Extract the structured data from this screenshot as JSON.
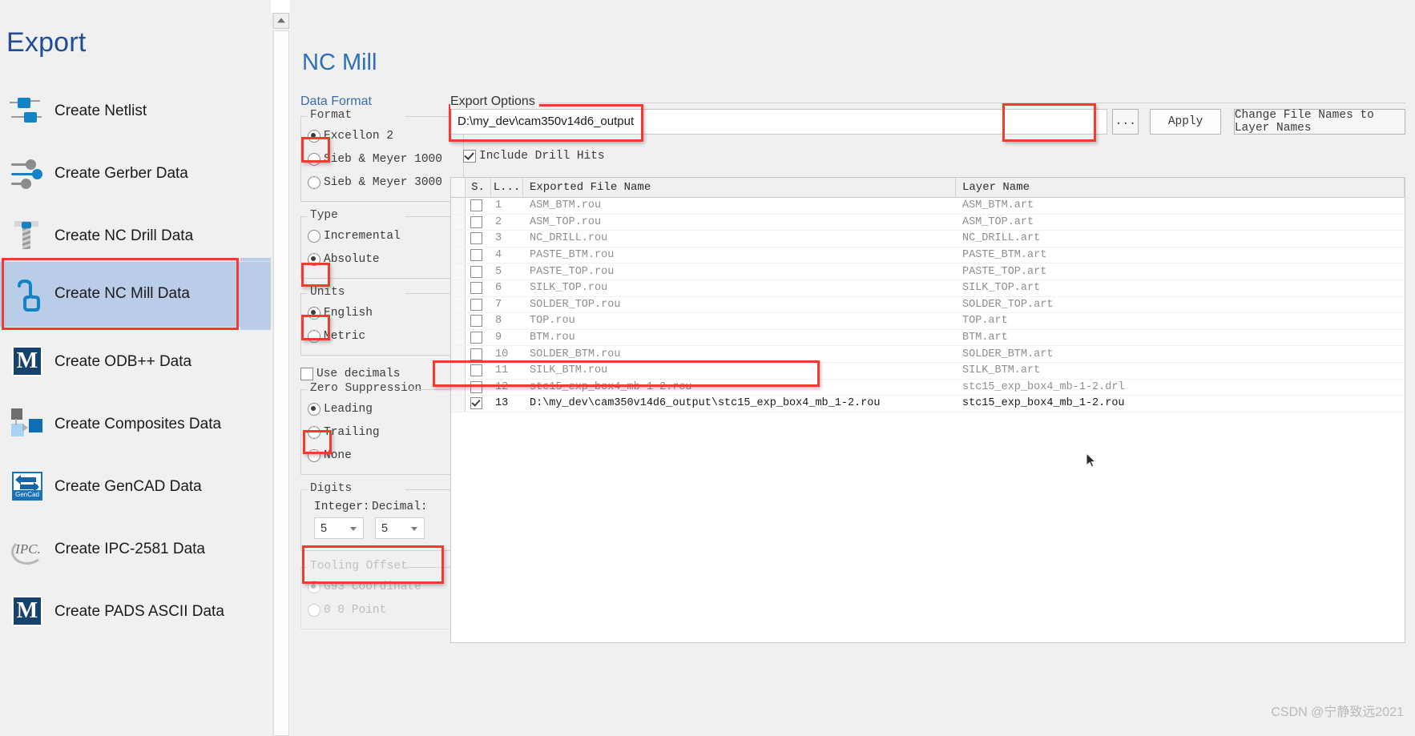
{
  "sidebar": {
    "title": "Export",
    "items": [
      {
        "label": "Create Netlist",
        "icon": "netlist-icon",
        "selected": false
      },
      {
        "label": "Create Gerber Data",
        "icon": "gerber-icon",
        "selected": false
      },
      {
        "label": "Create NC Drill Data",
        "icon": "drill-icon",
        "selected": false
      },
      {
        "label": "Create NC Mill Data",
        "icon": "mill-icon",
        "selected": true
      },
      {
        "label": "Create ODB++ Data",
        "icon": "odb-m-icon",
        "selected": false
      },
      {
        "label": "Create Composites Data",
        "icon": "composites-icon",
        "selected": false
      },
      {
        "label": "Create GenCAD Data",
        "icon": "gencad-icon",
        "selected": false
      },
      {
        "label": "Create IPC-2581 Data",
        "icon": "ipc-icon",
        "selected": false
      },
      {
        "label": "Create PADS ASCII Data",
        "icon": "pads-m-icon",
        "selected": false
      }
    ]
  },
  "main": {
    "title": "NC Mill",
    "data_format": {
      "title": "Data Format",
      "format": {
        "legend": "Format",
        "options": [
          {
            "label": "Excellon 2",
            "selected": true,
            "highlighted": true
          },
          {
            "label": "Sieb & Meyer 1000",
            "selected": false,
            "highlighted": false
          },
          {
            "label": "Sieb & Meyer 3000",
            "selected": false,
            "highlighted": false
          }
        ]
      },
      "type": {
        "legend": "Type",
        "options": [
          {
            "label": "Incremental",
            "selected": false,
            "highlighted": false
          },
          {
            "label": "Absolute",
            "selected": true,
            "highlighted": true
          }
        ]
      },
      "units": {
        "legend": "Units",
        "options": [
          {
            "label": "English",
            "selected": true,
            "highlighted": true
          },
          {
            "label": "Metric",
            "selected": false,
            "highlighted": false
          }
        ]
      },
      "use_decimals": {
        "label": "Use decimals",
        "checked": false
      },
      "zero_suppression": {
        "legend": "Zero Suppression",
        "options": [
          {
            "label": "Leading",
            "selected": true,
            "highlighted": true
          },
          {
            "label": "Trailing",
            "selected": false,
            "highlighted": false
          },
          {
            "label": "None",
            "selected": false,
            "highlighted": false
          }
        ]
      },
      "digits": {
        "legend": "Digits",
        "integer_label": "Integer:",
        "decimal_label": "Decimal:",
        "integer_value": "5",
        "decimal_value": "5"
      },
      "tooling_offset": {
        "legend": "Tooling Offset",
        "disabled": true,
        "options": [
          {
            "label": "G93 Coordinate",
            "selected": true
          },
          {
            "label": "0 0 Point",
            "selected": false
          }
        ]
      }
    },
    "export_options": {
      "legend": "Export Options",
      "path_value": "D:\\my_dev\\cam350v14d6_output",
      "browse_label": "...",
      "apply_label": "Apply",
      "change_names_label": "Change File Names to Layer Names",
      "include_drill_hits": {
        "label": "Include Drill Hits",
        "checked": true
      },
      "table": {
        "columns": [
          "S.",
          "L...",
          "Exported File Name",
          "Layer Name"
        ],
        "rows": [
          {
            "checked": false,
            "num": "1",
            "file": "ASM_BTM.rou",
            "layer": "ASM_BTM.art",
            "highlighted": false
          },
          {
            "checked": false,
            "num": "2",
            "file": "ASM_TOP.rou",
            "layer": "ASM_TOP.art",
            "highlighted": false
          },
          {
            "checked": false,
            "num": "3",
            "file": "NC_DRILL.rou",
            "layer": "NC_DRILL.art",
            "highlighted": false
          },
          {
            "checked": false,
            "num": "4",
            "file": "PASTE_BTM.rou",
            "layer": "PASTE_BTM.art",
            "highlighted": false
          },
          {
            "checked": false,
            "num": "5",
            "file": "PASTE_TOP.rou",
            "layer": "PASTE_TOP.art",
            "highlighted": false
          },
          {
            "checked": false,
            "num": "6",
            "file": "SILK_TOP.rou",
            "layer": "SILK_TOP.art",
            "highlighted": false
          },
          {
            "checked": false,
            "num": "7",
            "file": "SOLDER_TOP.rou",
            "layer": "SOLDER_TOP.art",
            "highlighted": false
          },
          {
            "checked": false,
            "num": "8",
            "file": "TOP.rou",
            "layer": "TOP.art",
            "highlighted": false
          },
          {
            "checked": false,
            "num": "9",
            "file": "BTM.rou",
            "layer": "BTM.art",
            "highlighted": false
          },
          {
            "checked": false,
            "num": "10",
            "file": "SOLDER_BTM.rou",
            "layer": "SOLDER_BTM.art",
            "highlighted": false
          },
          {
            "checked": false,
            "num": "11",
            "file": "SILK_BTM.rou",
            "layer": "SILK_BTM.art",
            "highlighted": false
          },
          {
            "checked": false,
            "num": "12",
            "file": "stc15_exp_box4_mb-1-2.rou",
            "layer": "stc15_exp_box4_mb-1-2.drl",
            "highlighted": false
          },
          {
            "checked": true,
            "num": "13",
            "file": "D:\\my_dev\\cam350v14d6_output\\stc15_exp_box4_mb_1-2.rou",
            "layer": "stc15_exp_box4_mb_1-2.rou",
            "highlighted": true
          }
        ]
      }
    }
  },
  "watermark": "CSDN @宁静致远2021",
  "colors": {
    "accent_blue": "#2e6fb7",
    "title_blue": "#1f4e95",
    "highlight_red": "#f03b2e",
    "selection_blue": "#b9cce8",
    "panel_bg": "#f0f0f0"
  }
}
